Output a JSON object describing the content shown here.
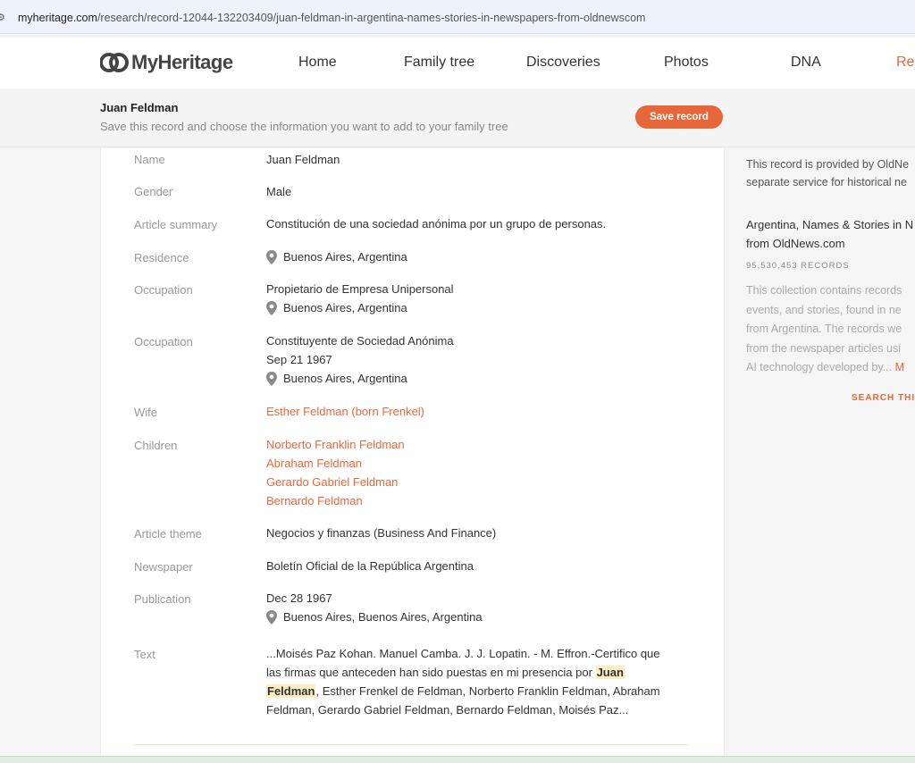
{
  "browser": {
    "url_host": "myheritage.com",
    "url_path": "/research/record-12044-132203409/juan-feldman-in-argentina-names-stories-in-newspapers-from-oldnewscom"
  },
  "nav": {
    "logo": "MyHeritage",
    "items": [
      "Home",
      "Family tree",
      "Discoveries",
      "Photos",
      "DNA",
      "Re"
    ]
  },
  "save_bar": {
    "title": "Juan Feldman",
    "subtitle": "Save this record and choose the information you want to add to your family tree",
    "button": "Save record"
  },
  "record": {
    "name_label": "Name",
    "name": "Juan Feldman",
    "gender_label": "Gender",
    "gender": "Male",
    "summary_label": "Article summary",
    "summary": "Constitución de una sociedad anónima por un grupo de personas.",
    "residence_label": "Residence",
    "residence": "Buenos Aires, Argentina",
    "occ1_label": "Occupation",
    "occ1_title": "Propietario de Empresa Unipersonal",
    "occ1_place": "Buenos Aires, Argentina",
    "occ2_label": "Occupation",
    "occ2_title": "Constituyente de Sociedad Anónima",
    "occ2_date": "Sep 21 1967",
    "occ2_place": "Buenos Aires, Argentina",
    "wife_label": "Wife",
    "wife": "Esther Feldman (born Frenkel)",
    "children_label": "Children",
    "children": [
      "Norberto Franklin Feldman",
      "Abraham Feldman",
      "Gerardo Gabriel Feldman",
      "Bernardo Feldman"
    ],
    "theme_label": "Article theme",
    "theme": "Negocios y finanzas (Business And Finance)",
    "newspaper_label": "Newspaper",
    "newspaper": "Boletín Oficial de la República Argentina",
    "publication_label": "Publication",
    "publication_date": "Dec 28 1967",
    "publication_place": "Buenos Aires, Buenos Aires, Argentina",
    "text_label": "Text",
    "text_before": "...Moisés Paz Kohan. Manuel Camba. J. J. Lopatin. - M. Effron.-Certifico que las firmas que anteceden han sido puestas en mi presencia por ",
    "text_highlight_1": "Juan",
    "text_highlight_2": "Feldman",
    "text_after": ", Esther Frenkel de Feldman, Norberto Franklin Feldman, Abraham Feldman, Gerardo Gabriel Feldman, Bernardo Feldman, Moisés Paz..."
  },
  "sidebar": {
    "provided_line1": "This record is provided by OldNe",
    "provided_line2": "separate service for historical ne",
    "collection_line1": "Argentina, Names & Stories in N",
    "collection_line2": "from OldNews.com",
    "records_count": "95,530,453 RECORDS",
    "desc_lines": [
      "This collection contains records",
      "events, and stories, found in ne",
      "from Argentina. The records we",
      "from the newspaper articles usi",
      "AI technology developed by..."
    ],
    "more": "M",
    "search_link": "SEARCH THIS"
  },
  "colors": {
    "accent": "#e8673a",
    "highlight": "#fdeec2"
  },
  "icons": {
    "location": "location-pin-icon",
    "logo": "myheritage-logo-icon"
  }
}
